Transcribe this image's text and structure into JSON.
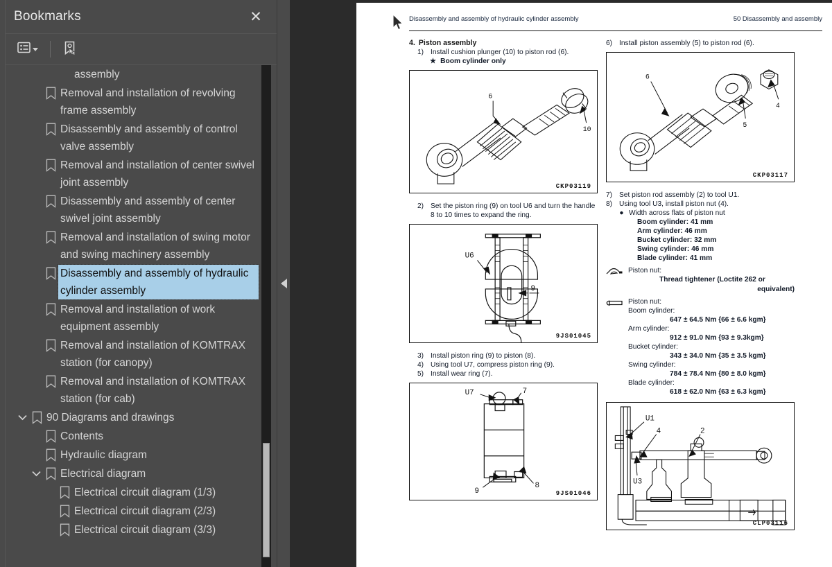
{
  "sidebar": {
    "title": "Bookmarks",
    "close_label": "✕",
    "toolbar": {
      "list_view_label": "list-options",
      "new_bookmark_label": "new-bookmark"
    },
    "items": [
      {
        "label": "assembly",
        "depth": 2,
        "icon": false,
        "chevron": "none",
        "selected": false,
        "partial": true
      },
      {
        "label": "Removal and installation of revolving frame assembly",
        "depth": 1,
        "icon": true,
        "chevron": "none",
        "selected": false
      },
      {
        "label": "Disassembly and assembly of control valve assembly",
        "depth": 1,
        "icon": true,
        "chevron": "none",
        "selected": false
      },
      {
        "label": "Removal and installation of center swivel joint assembly",
        "depth": 1,
        "icon": true,
        "chevron": "none",
        "selected": false
      },
      {
        "label": "Disassembly and assembly of center swivel joint assembly",
        "depth": 1,
        "icon": true,
        "chevron": "none",
        "selected": false
      },
      {
        "label": "Removal and installation of swing motor and swing machinery assembly",
        "depth": 1,
        "icon": true,
        "chevron": "none",
        "selected": false
      },
      {
        "label": "Disassembly and assembly of hydraulic cylinder assembly",
        "depth": 1,
        "icon": true,
        "chevron": "none",
        "selected": true
      },
      {
        "label": "Removal and installation of work equipment assembly",
        "depth": 1,
        "icon": true,
        "chevron": "none",
        "selected": false
      },
      {
        "label": "Removal and installation of KOMTRAX station (for canopy)",
        "depth": 1,
        "icon": true,
        "chevron": "none",
        "selected": false
      },
      {
        "label": "Removal and installation of KOMTRAX station (for cab)",
        "depth": 1,
        "icon": true,
        "chevron": "none",
        "selected": false
      },
      {
        "label": "90 Diagrams and drawings",
        "depth": 0,
        "icon": true,
        "chevron": "down",
        "selected": false
      },
      {
        "label": "Contents",
        "depth": 1,
        "icon": true,
        "chevron": "none",
        "selected": false
      },
      {
        "label": "Hydraulic diagram",
        "depth": 1,
        "icon": true,
        "chevron": "none",
        "selected": false
      },
      {
        "label": "Electrical diagram",
        "depth": 1,
        "icon": true,
        "chevron": "down",
        "selected": false
      },
      {
        "label": "Electrical circuit diagram (1/3)",
        "depth": 2,
        "icon": true,
        "chevron": "none",
        "selected": false
      },
      {
        "label": "Electrical circuit diagram (2/3)",
        "depth": 2,
        "icon": true,
        "chevron": "none",
        "selected": false
      },
      {
        "label": "Electrical circuit diagram (3/3)",
        "depth": 2,
        "icon": true,
        "chevron": "none",
        "selected": false
      }
    ]
  },
  "collapse_handle": {
    "label": "collapse-sidebar"
  },
  "document": {
    "header_left": "Disassembly and assembly of hydraulic cylinder assembly",
    "header_right": "50 Disassembly and assembly",
    "left_column": {
      "section_number": "4.",
      "section_title": "Piston assembly",
      "step1_num": "1)",
      "step1_text": "Install cushion plunger (10) to piston rod (6).",
      "note_star": "★",
      "note_text": "Boom cylinder only",
      "fig1_caption": "CKP03119",
      "fig1_callouts": [
        "6",
        "10"
      ],
      "step2_num": "2)",
      "step2_text": "Set the piston ring (9) on tool U6 and turn the handle 8 to 10 times to expand the ring.",
      "fig2_caption": "9JS01045",
      "fig2_callouts": [
        "U6",
        "9"
      ],
      "step3_num": "3)",
      "step3_text": "Install piston ring (9) to piston (8).",
      "step4_num": "4)",
      "step4_text": "Using tool U7, compress piston ring (9).",
      "step5_num": "5)",
      "step5_text": "Install wear ring (7).",
      "fig3_caption": "9JS01046",
      "fig3_callouts": [
        "U7",
        "7",
        "9",
        "8"
      ]
    },
    "right_column": {
      "step6_num": "6)",
      "step6_text": "Install piston assembly (5) to piston rod (6).",
      "fig4_caption": "CKP03117",
      "fig4_callouts": [
        "6",
        "5",
        "4"
      ],
      "step7_num": "7)",
      "step7_text": "Set piston rod assembly (2) to tool U1.",
      "step8_num": "8)",
      "step8_text": "Using tool U3, install piston nut (4).",
      "bullet": "●",
      "width_heading": "Width across flats of piston nut",
      "width_specs": [
        "Boom cylinder: 41 mm",
        "Arm cylinder: 46 mm",
        "Bucket cylinder: 32 mm",
        "Swing cylinder: 46 mm",
        "Blade cylinder: 41 mm"
      ],
      "adhesive_title": "Piston nut:",
      "adhesive_line1": "Thread tightener (Loctite 262 or",
      "adhesive_line2": "equivalent)",
      "torque_title": "Piston nut:",
      "torque_specs": [
        {
          "name": "Boom cylinder:",
          "value": "647 ± 64.5 Nm {66 ± 6.6 kgm}"
        },
        {
          "name": "Arm cylinder:",
          "value": "912 ± 91.0 Nm {93 ± 9.3kgm}"
        },
        {
          "name": "Bucket cylinder:",
          "value": "343 ± 34.0 Nm {35 ± 3.5 kgm}"
        },
        {
          "name": "Swing cylinder:",
          "value": "784 ± 78.4 Nm {80 ± 8.0 kgm}"
        },
        {
          "name": "Blade cylinder:",
          "value": "618 ± 62.0 Nm {63 ± 6.3 kgm}"
        }
      ],
      "fig5_caption": "CLP03116",
      "fig5_callouts": [
        "U1",
        "U3",
        "4",
        "2"
      ]
    }
  },
  "colors": {
    "sidebar_bg": "#4a4a4a",
    "viewer_bg": "#2b2b2b",
    "selection": "#a8cfe8",
    "page_bg": "#ffffff"
  }
}
